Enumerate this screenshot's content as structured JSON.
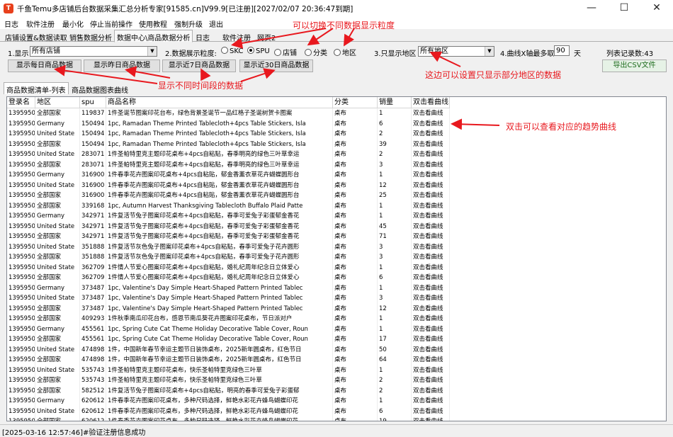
{
  "window": {
    "title": "千鱼Temu多店铺后台数据采集汇总分析专家[91585.cn]V99.9[已注册][2027/02/07 20:36:47到期]",
    "icon": "app-logo-icon"
  },
  "menu": [
    "日志",
    "软件注册",
    "最小化",
    "停止当前操作",
    "使用教程",
    "强制升级",
    "退出"
  ],
  "tabs": [
    "店铺设置&数据读取",
    "销售数据分析",
    "数据中心\\商品数据分析",
    "日志",
    "软件注册",
    "网页2"
  ],
  "controls": {
    "show_label": "1.显示",
    "show_value": "所有店铺",
    "granularity_label": "2.数据展示粒度:",
    "granularity_options": [
      "SKC",
      "SPU",
      "店铺",
      "分类",
      "地区"
    ],
    "granularity_selected": "SPU",
    "region_label": "3.只显示地区",
    "region_value": "所有地区",
    "days_label": "4.曲线X轴最多取",
    "days_value": "90",
    "days_unit": "天",
    "record_count": "列表记录数:43"
  },
  "buttons": {
    "daily": "显示每日商品数据",
    "yesterday": "显示昨日商品数据",
    "last7": "显示近7日商品数据",
    "last30": "显示近30日商品数据",
    "export": "导出CSV文件"
  },
  "subtabs": [
    "商品数据清单-列表",
    "商品数据图表曲线"
  ],
  "table": {
    "columns": [
      "登录名",
      "地区",
      "spu",
      "商品名称",
      "分类",
      "销量",
      "双击看曲线"
    ],
    "rows": [
      [
        "1395950",
        "全部国家",
        "119837",
        "1件圣诞节图案印花台布，绿色背景圣诞节一品红格子圣诞树贺卡图案",
        "桌布",
        "1",
        "双击看曲线"
      ],
      [
        "1395950",
        "Germany",
        "150494",
        "1pc, Ramadan Theme Printed Tablecloth+4pcs Table Stickers, Isla",
        "桌布",
        "6",
        "双击看曲线"
      ],
      [
        "1395950",
        "United State",
        "150494",
        "1pc, Ramadan Theme Printed Tablecloth+4pcs Table Stickers, Isla",
        "桌布",
        "2",
        "双击看曲线"
      ],
      [
        "1395950",
        "全部国家",
        "150494",
        "1pc, Ramadan Theme Printed Tablecloth+4pcs Table Stickers, Isla",
        "桌布",
        "39",
        "双击看曲线"
      ],
      [
        "1395950",
        "United State",
        "283071",
        "1件圣帕特里克主题印花桌布+4pcs自粘贴，春季明亮的绿色三叶草幸运",
        "桌布",
        "2",
        "双击看曲线"
      ],
      [
        "1395950",
        "全部国家",
        "283071",
        "1件圣帕特里克主题印花桌布+4pcs自粘贴，春季明亮的绿色三叶草幸运",
        "桌布",
        "3",
        "双击看曲线"
      ],
      [
        "1395950",
        "Germany",
        "316900",
        "1件春季花卉图案印花桌布+4pcs自粘贴，郁金香薰衣草花卉蝴蝶圆形台",
        "桌布",
        "1",
        "双击看曲线"
      ],
      [
        "1395950",
        "United State",
        "316900",
        "1件春季花卉图案印花桌布+4pcs自粘贴，郁金香薰衣草花卉蝴蝶圆形台",
        "桌布",
        "12",
        "双击看曲线"
      ],
      [
        "1395950",
        "全部国家",
        "316900",
        "1件春季花卉图案印花桌布+4pcs自粘贴，郁金香薰衣草花卉蝴蝶圆形台",
        "桌布",
        "25",
        "双击看曲线"
      ],
      [
        "1395950",
        "全部国家",
        "339168",
        "1pc, Autumn Harvest Thanksgiving Tablecloth Buffalo Plaid Patte",
        "桌布",
        "1",
        "双击看曲线"
      ],
      [
        "1395950",
        "Germany",
        "342971",
        "1件复活节兔子图案印花桌布+4pcs自粘贴，春季可爱兔子彩蛋郁金香花",
        "桌布",
        "1",
        "双击看曲线"
      ],
      [
        "1395950",
        "United State",
        "342971",
        "1件复活节兔子图案印花桌布+4pcs自粘贴，春季可爱兔子彩蛋郁金香花",
        "桌布",
        "45",
        "双击看曲线"
      ],
      [
        "1395950",
        "全部国家",
        "342971",
        "1件复活节兔子图案印花桌布+4pcs自粘贴，春季可爱兔子彩蛋郁金香花",
        "桌布",
        "71",
        "双击看曲线"
      ],
      [
        "1395950",
        "United State",
        "351888",
        "1件复活节灰色兔子图案印花桌布+4pcs自粘贴，春季可爱兔子花卉圆形",
        "桌布",
        "3",
        "双击看曲线"
      ],
      [
        "1395950",
        "全部国家",
        "351888",
        "1件复活节灰色兔子图案印花桌布+4pcs自粘贴，春季可爱兔子花卉圆形",
        "桌布",
        "3",
        "双击看曲线"
      ],
      [
        "1395950",
        "United State",
        "362709",
        "1件情人节爱心图案印花桌布+4pcs自粘贴，婚礼纪周年纪念日立体爱心",
        "桌布",
        "1",
        "双击看曲线"
      ],
      [
        "1395950",
        "全部国家",
        "362709",
        "1件情人节爱心图案印花桌布+4pcs自粘贴，婚礼纪周年纪念日立体爱心",
        "桌布",
        "6",
        "双击看曲线"
      ],
      [
        "1395950",
        "Germany",
        "373487",
        "1pc, Valentine's Day Simple Heart-Shaped Pattern Printed Tablec",
        "桌布",
        "1",
        "双击看曲线"
      ],
      [
        "1395950",
        "United State",
        "373487",
        "1pc, Valentine's Day Simple Heart-Shaped Pattern Printed Tablec",
        "桌布",
        "3",
        "双击看曲线"
      ],
      [
        "1395950",
        "全部国家",
        "373487",
        "1pc, Valentine's Day Simple Heart-Shaped Pattern Printed Tablec",
        "桌布",
        "12",
        "双击看曲线"
      ],
      [
        "1395950",
        "全部国家",
        "409293",
        "1件秋季南瓜印花台布，感恩节南瓜葵花卉图案印花桌布，节日派对户",
        "桌布",
        "1",
        "双击看曲线"
      ],
      [
        "1395950",
        "Germany",
        "455561",
        "1pc, Spring Cute Cat Theme Holiday Decorative Table Cover, Roun",
        "桌布",
        "1",
        "双击看曲线"
      ],
      [
        "1395950",
        "全部国家",
        "455561",
        "1pc, Spring Cute Cat Theme Holiday Decorative Table Cover, Roun",
        "桌布",
        "17",
        "双击看曲线"
      ],
      [
        "1395950",
        "United State",
        "474898",
        "1件，中国新年春节幸运主题节日装饰桌布，2025新年圆桌布，红色节日",
        "桌布",
        "50",
        "双击看曲线"
      ],
      [
        "1395950",
        "全部国家",
        "474898",
        "1件，中国新年春节幸运主题节日装饰桌布，2025新年圆桌布，红色节日",
        "桌布",
        "64",
        "双击看曲线"
      ],
      [
        "1395950",
        "United State",
        "535743",
        "1件圣帕特里克主题印花桌布，快乐圣帕特里克绿色三叶草",
        "桌布",
        "1",
        "双击看曲线"
      ],
      [
        "1395950",
        "全部国家",
        "535743",
        "1件圣帕特里克主题印花桌布，快乐圣帕特里克绿色三叶草",
        "桌布",
        "2",
        "双击看曲线"
      ],
      [
        "1395950",
        "全部国家",
        "582512",
        "1件复活节兔子图案印花桌布+4pcs自粘贴，明亮的春季可爱兔子彩蛋郁",
        "桌布",
        "2",
        "双击看曲线"
      ],
      [
        "1395950",
        "Germany",
        "620612",
        "1件春季花卉图案印花桌布，多种尺码选择，鲜艳水彩花卉蜂鸟蝴蝶印花",
        "桌布",
        "1",
        "双击看曲线"
      ],
      [
        "1395950",
        "United State",
        "620612",
        "1件春季花卉图案印花桌布，多种尺码选择，鲜艳水彩花卉蜂鸟蝴蝶印花",
        "桌布",
        "6",
        "双击看曲线"
      ],
      [
        "1395950",
        "全部国家",
        "620612",
        "1件春季花卉图案印花桌布，多种尺码选择，鲜艳水彩花卉蜂鸟蝴蝶印花",
        "桌布",
        "19",
        "双击看曲线"
      ]
    ]
  },
  "status": "[2025-03-16 12:57:46]#验证注册信息成功",
  "annotations": {
    "granularity": "可以切换不同数据显示粒度",
    "time_periods": "显示不同时间段的数据",
    "region": "这边可以设置只显示部分地区的数据",
    "double_click": "双击可以查看对应的趋势曲线"
  },
  "colors": {
    "annotation": "#e8181e",
    "window_bg": "#f0f0f0"
  }
}
